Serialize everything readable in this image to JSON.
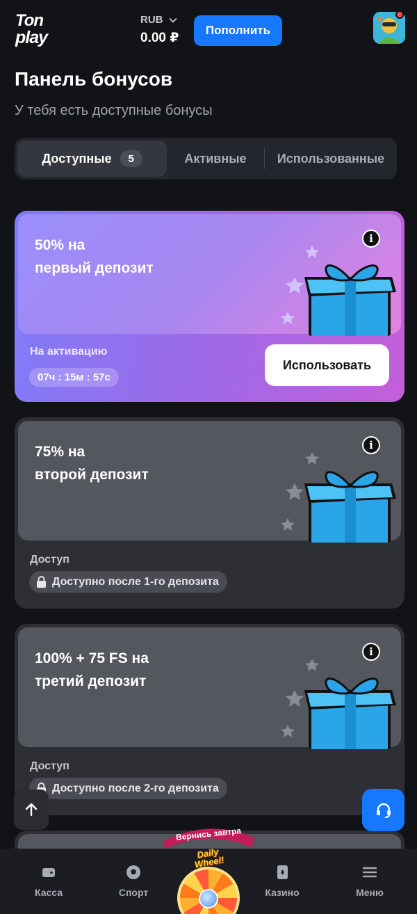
{
  "header": {
    "logo_line1": "Ton",
    "logo_line2": "play",
    "currency": "RUB",
    "balance": "0.00 ₽",
    "deposit_label": "Пополнить"
  },
  "page": {
    "title": "Панель бонусов",
    "subtitle": "У тебя есть доступные бонусы"
  },
  "tabs": [
    {
      "label": "Доступные",
      "count": "5",
      "active": true
    },
    {
      "label": "Активные"
    },
    {
      "label": "Использованные"
    }
  ],
  "bonuses": [
    {
      "title_line1": "50%  на",
      "title_line2": "первый депозит",
      "status_label": "На активацию",
      "timer": "07ч : 15м : 57с",
      "action_label": "Использовать"
    },
    {
      "title_line1": "75%  на",
      "title_line2": "второй депозит",
      "status_label": "Доступ",
      "lock_text": "Доступно после 1-го депозита"
    },
    {
      "title_line1": "100% + 75 FS на",
      "title_line2": "третий депозит",
      "status_label": "Доступ",
      "lock_text": "Доступно после 2-го депозита"
    }
  ],
  "promo": {
    "ribbon": "Вернись завтра",
    "wheel_line1": "Daily",
    "wheel_line2": "Wheel!"
  },
  "nav": [
    {
      "label": "Касса",
      "icon": "wallet-icon"
    },
    {
      "label": "Спорт",
      "icon": "soccer-ball-icon"
    },
    {
      "label": "Казино",
      "icon": "cards-icon"
    },
    {
      "label": "Меню",
      "icon": "hamburger-icon"
    }
  ],
  "colors": {
    "accent": "#1677ff",
    "background": "#111317",
    "card": "#2d2f35"
  }
}
